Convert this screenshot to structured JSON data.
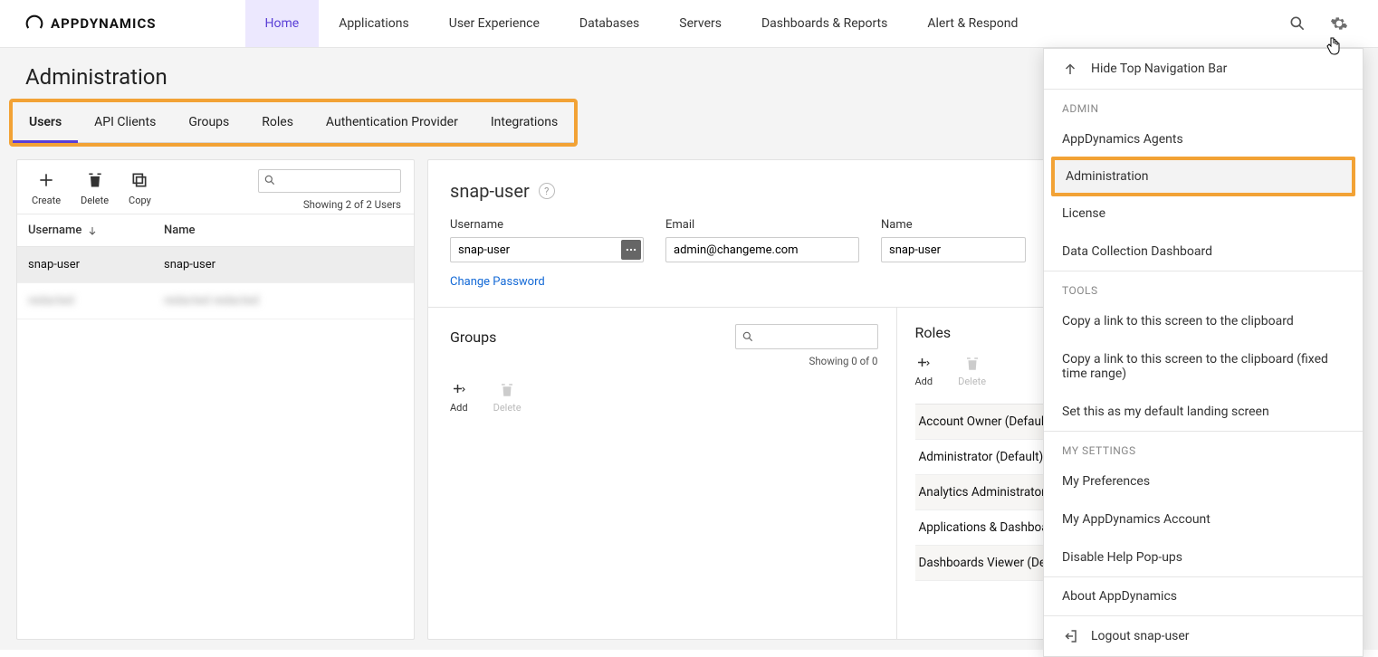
{
  "brand": "APPDYNAMICS",
  "topnav": [
    "Home",
    "Applications",
    "User Experience",
    "Databases",
    "Servers",
    "Dashboards & Reports",
    "Alert & Respond"
  ],
  "page_title": "Administration",
  "subtabs": [
    "Users",
    "API Clients",
    "Groups",
    "Roles",
    "Authentication Provider",
    "Integrations"
  ],
  "toolbar": {
    "create": "Create",
    "delete": "Delete",
    "copy": "Copy"
  },
  "showing": "Showing 2 of 2 Users",
  "columns": {
    "username": "Username",
    "name": "Name"
  },
  "rows": [
    {
      "username": "snap-user",
      "name": "snap-user"
    },
    {
      "username": "████████",
      "name": "████████"
    }
  ],
  "detail": {
    "title": "snap-user",
    "labels": {
      "username": "Username",
      "email": "Email",
      "name": "Name"
    },
    "values": {
      "username": "snap-user",
      "email": "admin@changeme.com",
      "name": "snap-user"
    },
    "change_password": "Change Password"
  },
  "groups": {
    "title": "Groups",
    "add": "Add",
    "delete": "Delete",
    "showing": "Showing 0 of 0"
  },
  "roles": {
    "title": "Roles",
    "add": "Add",
    "delete": "Delete",
    "items": [
      "Account Owner (Default)",
      "Administrator (Default)",
      "Analytics Administrator (Default)",
      "Applications & Dashboards Viewer",
      "Dashboards Viewer (Default)"
    ]
  },
  "menu": {
    "hide": "Hide Top Navigation Bar",
    "admin_header": "ADMIN",
    "admin": [
      "AppDynamics Agents",
      "Administration",
      "License",
      "Data Collection Dashboard"
    ],
    "tools_header": "TOOLS",
    "tools": [
      "Copy a link to this screen to the clipboard",
      "Copy a link to this screen to the clipboard (fixed time range)",
      "Set this as my default landing screen"
    ],
    "settings_header": "MY SETTINGS",
    "settings": [
      "My Preferences",
      "My AppDynamics Account",
      "Disable Help Pop-ups"
    ],
    "about": "About AppDynamics",
    "logout": "Logout snap-user"
  }
}
